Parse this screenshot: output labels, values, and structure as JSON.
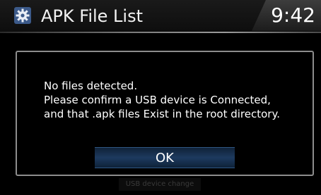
{
  "header": {
    "icon": "gear-icon",
    "title": "APK File List",
    "clock": "9:42"
  },
  "dialog": {
    "message_lines": [
      "No files detected.",
      "Please confirm a USB device is Connected,",
      "and that .apk files Exist in the root directory."
    ],
    "ok_label": "OK"
  },
  "footer": {
    "hidden_button_label": "USB device change"
  },
  "colors": {
    "background": "#000000",
    "dialog_border": "#8d8d8d",
    "ok_button": "#1d3a5f"
  }
}
